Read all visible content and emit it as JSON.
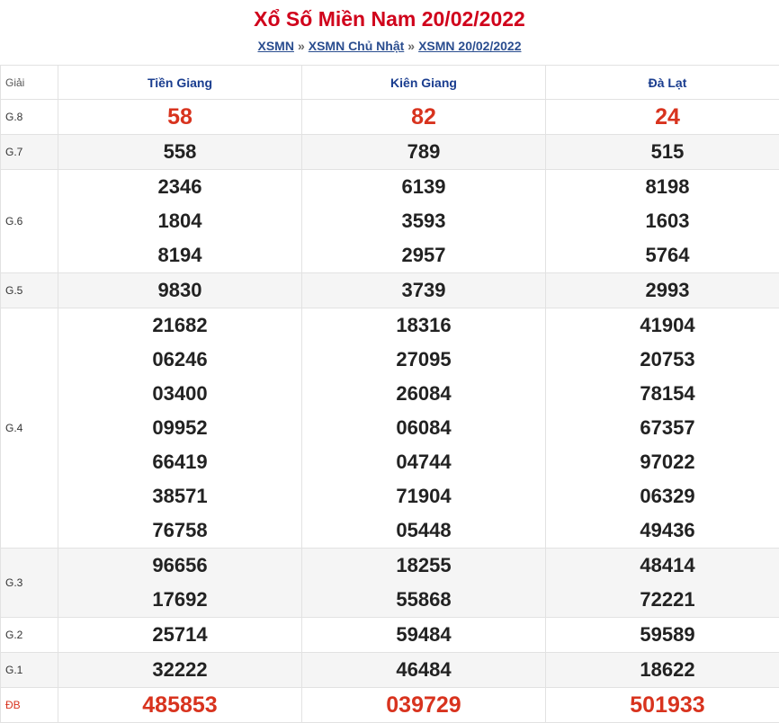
{
  "header": {
    "title": "Xổ Số Miền Nam 20/02/2022",
    "breadcrumb": [
      {
        "label": "XSMN"
      },
      {
        "label": "XSMN Chủ Nhật"
      },
      {
        "label": "XSMN 20/02/2022"
      }
    ],
    "separator": "»"
  },
  "table": {
    "label_header": "Giải",
    "provinces": [
      "Tiền Giang",
      "Kiên Giang",
      "Đà Lạt"
    ],
    "prizes": [
      {
        "label": "G.8",
        "values": [
          [
            "58"
          ],
          [
            "82"
          ],
          [
            "24"
          ]
        ]
      },
      {
        "label": "G.7",
        "values": [
          [
            "558"
          ],
          [
            "789"
          ],
          [
            "515"
          ]
        ]
      },
      {
        "label": "G.6",
        "values": [
          [
            "2346",
            "1804",
            "8194"
          ],
          [
            "6139",
            "3593",
            "2957"
          ],
          [
            "8198",
            "1603",
            "5764"
          ]
        ]
      },
      {
        "label": "G.5",
        "values": [
          [
            "9830"
          ],
          [
            "3739"
          ],
          [
            "2993"
          ]
        ]
      },
      {
        "label": "G.4",
        "values": [
          [
            "21682",
            "06246",
            "03400",
            "09952",
            "66419",
            "38571",
            "76758"
          ],
          [
            "18316",
            "27095",
            "26084",
            "06084",
            "04744",
            "71904",
            "05448"
          ],
          [
            "41904",
            "20753",
            "78154",
            "67357",
            "97022",
            "06329",
            "49436"
          ]
        ]
      },
      {
        "label": "G.3",
        "values": [
          [
            "96656",
            "17692"
          ],
          [
            "18255",
            "55868"
          ],
          [
            "48414",
            "72221"
          ]
        ]
      },
      {
        "label": "G.2",
        "values": [
          [
            "25714"
          ],
          [
            "59484"
          ],
          [
            "59589"
          ]
        ]
      },
      {
        "label": "G.1",
        "values": [
          [
            "32222"
          ],
          [
            "46484"
          ],
          [
            "18622"
          ]
        ]
      },
      {
        "label": "ĐB",
        "values": [
          [
            "485853"
          ],
          [
            "039729"
          ],
          [
            "501933"
          ]
        ]
      }
    ]
  }
}
